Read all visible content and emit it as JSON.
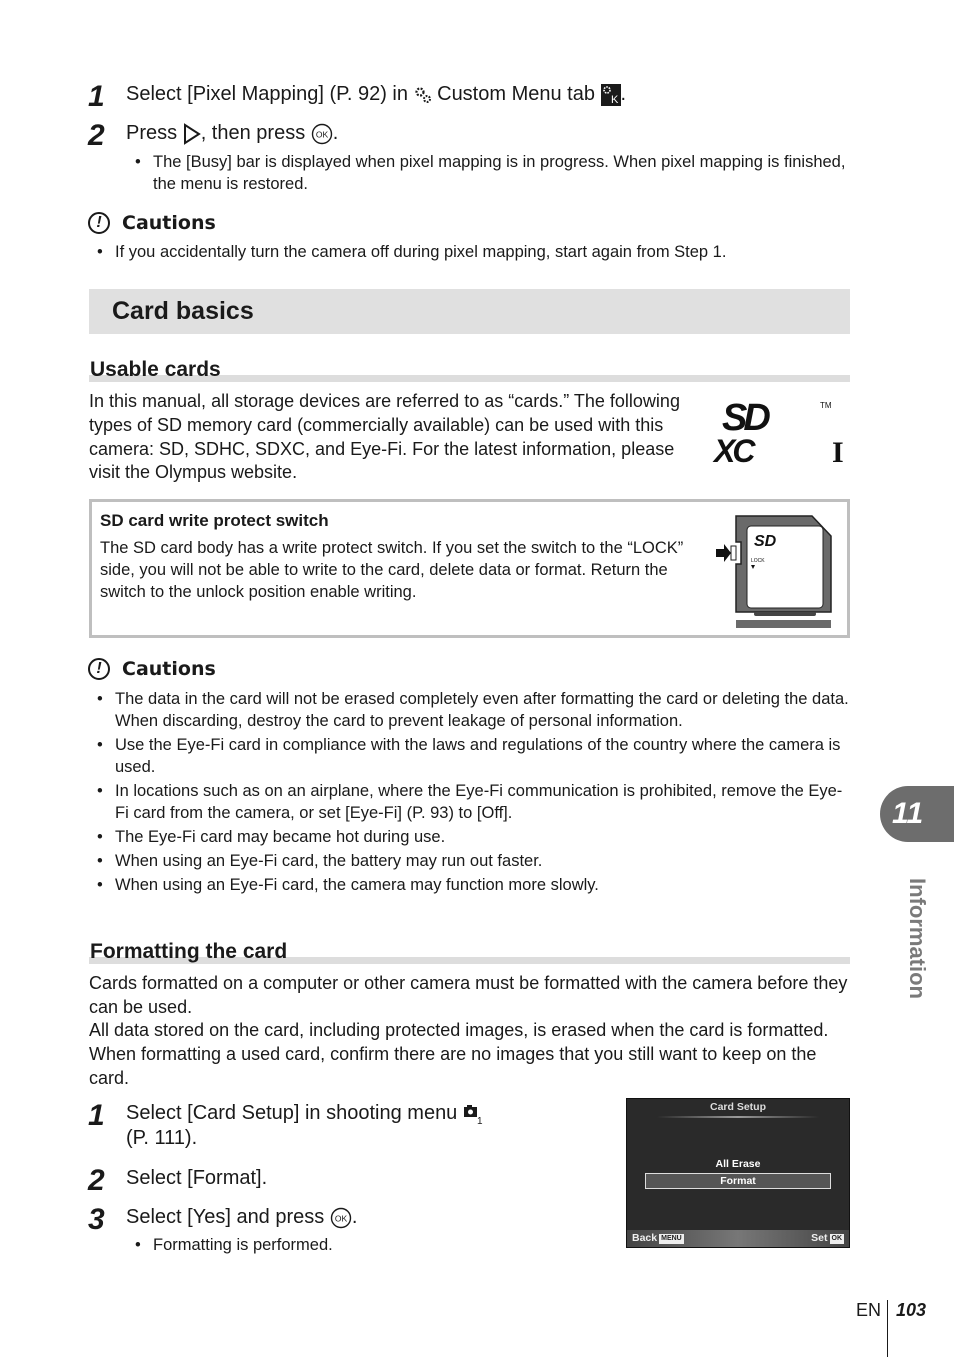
{
  "pixel_mapping_steps": [
    {
      "num": "1",
      "text_before": "Select [Pixel Mapping] (P. 92) in ",
      "text_mid": " Custom Menu tab ",
      "text_after": ".",
      "icons": [
        "custom-menu-gear-icon",
        "custom-menu-tab-k-icon"
      ]
    },
    {
      "num": "2",
      "text_before": "Press ",
      "text_mid": ", then press ",
      "text_after": ".",
      "icons": [
        "right-arrow-button-icon",
        "ok-button-icon"
      ]
    }
  ],
  "pixel_mapping_bullets": [
    "The [Busy] bar is displayed when pixel mapping is in progress. When pixel mapping is finished, the menu is restored."
  ],
  "cautions_1": {
    "label": "Cautions",
    "items": [
      "If you accidentally turn the camera off during pixel mapping, start again from Step 1."
    ]
  },
  "section": {
    "title": "Card basics"
  },
  "usable_cards": {
    "heading": "Usable cards",
    "body": "In this manual, all storage devices are referred to as “cards.” The following types of SD memory card (commercially available) can be used with this camera: SD, SDHC, SDXC, and Eye-Fi. For the latest information, please visit the Olympus website.",
    "logo": {
      "sd": "SD",
      "xc": "XC",
      "class": "I",
      "tm": "TM"
    }
  },
  "write_protect_box": {
    "title": "SD card write protect switch",
    "body": "The SD card body has a write protect switch. If you set the switch to the “LOCK” side, you will not be able to write to the card, delete data or format. Return the switch to the unlock position enable writing.",
    "card_illustration": {
      "logo": "SD",
      "lock_label": "LOCK"
    }
  },
  "cautions_2": {
    "label": "Cautions",
    "items": [
      "The data in the card will not be erased completely even after formatting the card or deleting the data. When discarding, destroy the card to prevent leakage of personal information.",
      "Use the Eye-Fi card in compliance with the laws and regulations of the country where the camera is used.",
      "In locations such as on an airplane, where the Eye-Fi communication is prohibited, remove the Eye-Fi card from the camera, or set [Eye-Fi] (P. 93) to [Off].",
      "The Eye-Fi card may became hot during use.",
      "When using an Eye-Fi card, the battery may run out faster.",
      "When using an Eye-Fi card, the camera may function more slowly."
    ]
  },
  "formatting": {
    "heading": "Formatting the card",
    "body_1": "Cards formatted on a computer or other camera must be formatted with the camera before they can be used.",
    "body_2": "All data stored on the card, including protected images, is erased when the card is formatted. When formatting a used card, confirm there are no images that you still want to keep on the card.",
    "steps": [
      {
        "num": "1",
        "text_before": "Select [Card Setup] in shooting menu ",
        "text_after": "(P. 111).",
        "icon": "shooting-menu-1-icon"
      },
      {
        "num": "2",
        "text": "Select [Format]."
      },
      {
        "num": "3",
        "text_before": "Select [Yes] and press ",
        "text_after": ".",
        "icon": "ok-button-icon"
      }
    ],
    "bullets": [
      "Formatting is performed."
    ]
  },
  "camera_screen": {
    "title": "Card Setup",
    "items": [
      "All Erase",
      "Format"
    ],
    "selected_index": 1,
    "back_label": "Back",
    "back_key": "MENU",
    "set_label": "Set",
    "set_key": "OK"
  },
  "chapter_tab": {
    "number": "11",
    "label": "Information"
  },
  "page_footer": {
    "language": "EN",
    "page_number": "103"
  }
}
